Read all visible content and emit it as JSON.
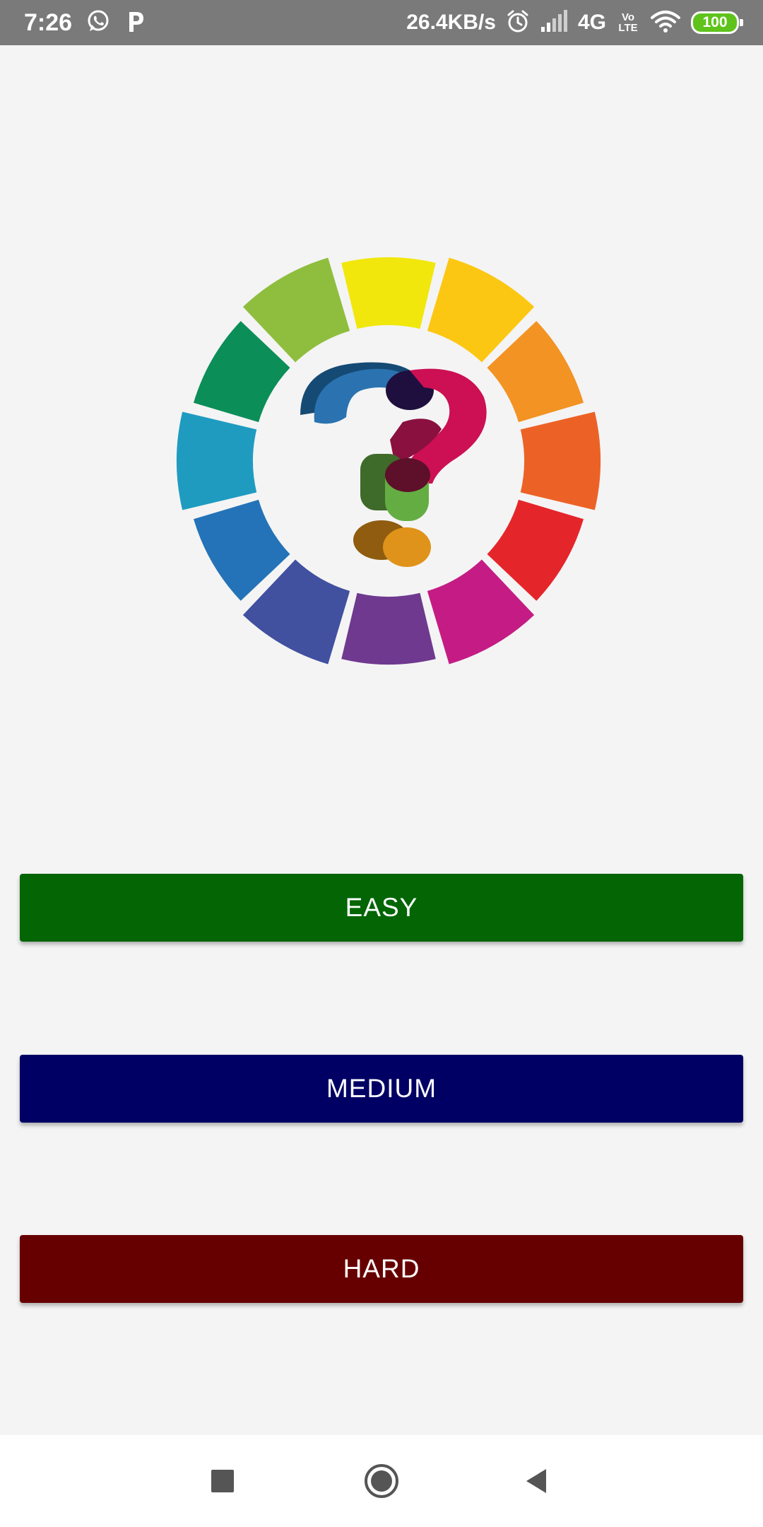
{
  "status_bar": {
    "time": "7:26",
    "left_icons": [
      "whatsapp-icon",
      "p-notification-icon"
    ],
    "network_speed": "26.4KB/s",
    "network_type": "4G",
    "volte_line1": "Vo",
    "volte_line2": "LTE",
    "battery_level": "100",
    "right_icons": [
      "alarm-icon",
      "signal-icon",
      "wifi-icon",
      "battery-icon"
    ],
    "background_color": "#7a7a7a",
    "battery_color": "#5fc31b"
  },
  "logo": {
    "icon": "color-wheel-question-mark-logo",
    "wheel_colors": [
      "#f1e70c",
      "#fcc713",
      "#f39323",
      "#ec6226",
      "#e4262a",
      "#c41c84",
      "#6f398f",
      "#41509f",
      "#2473b8",
      "#1f9bc0",
      "#0b8e58",
      "#8fbe3f"
    ]
  },
  "buttons": {
    "easy": {
      "label": "EASY",
      "color": "#036504"
    },
    "medium": {
      "label": "MEDIUM",
      "color": "#000064"
    },
    "hard": {
      "label": "HARD",
      "color": "#660000"
    }
  },
  "nav_bar": {
    "icons": [
      "recents-square-icon",
      "home-circle-icon",
      "back-triangle-icon"
    ]
  }
}
